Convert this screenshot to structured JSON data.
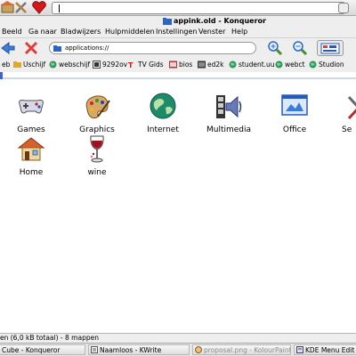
{
  "window": {
    "title": "appink.old - Konqueror"
  },
  "panel": {
    "search_value": ""
  },
  "menu": {
    "items": [
      "Beeld",
      "Ga naar",
      "Bladwijzers",
      "Hulpmiddelen",
      "Instellingen",
      "Venster",
      "Help"
    ]
  },
  "location": {
    "url": "applications://"
  },
  "bookmarks": {
    "items": [
      {
        "label": "eb",
        "icon": "globe-icon"
      },
      {
        "label": "Uschijf",
        "icon": "folder-icon"
      },
      {
        "label": "webschijf",
        "icon": "globe-icon"
      },
      {
        "label": "9292ov",
        "icon": "bookmark-icon"
      },
      {
        "label": "TV Gids",
        "icon": "tv-icon"
      },
      {
        "label": "bios",
        "icon": "film-icon"
      },
      {
        "label": "ed2k",
        "icon": "film-icon"
      },
      {
        "label": "student.uu",
        "icon": "globe-icon"
      },
      {
        "label": "webct",
        "icon": "globe-icon"
      },
      {
        "label": "Studion",
        "icon": "globe-icon"
      }
    ]
  },
  "folders": {
    "items": [
      {
        "label": "Games",
        "icon": "gamepad-icon"
      },
      {
        "label": "Graphics",
        "icon": "paint-palette-icon"
      },
      {
        "label": "Internet",
        "icon": "globe-icon"
      },
      {
        "label": "Multimedia",
        "icon": "film-speaker-icon"
      },
      {
        "label": "Office",
        "icon": "office-document-icon"
      },
      {
        "label": "Se",
        "icon": "settings-icon"
      },
      {
        "label": "Home",
        "icon": "house-icon"
      },
      {
        "label": "wine",
        "icon": "wine-glass-icon"
      }
    ]
  },
  "status": {
    "text": "en (6,0 kB totaal) - 8 mappen"
  },
  "taskbar": {
    "items": [
      {
        "label": "Cube - Konqueror",
        "dim": false
      },
      {
        "label": "Naamloos - KWrite",
        "dim": false
      },
      {
        "label": "proposal.png - KolourPaint",
        "dim": true
      },
      {
        "label": "KDE Menu Edit",
        "dim": false
      }
    ]
  },
  "colors": {
    "accent": "#3b63c9",
    "selection_line": "#cdd9e6"
  }
}
